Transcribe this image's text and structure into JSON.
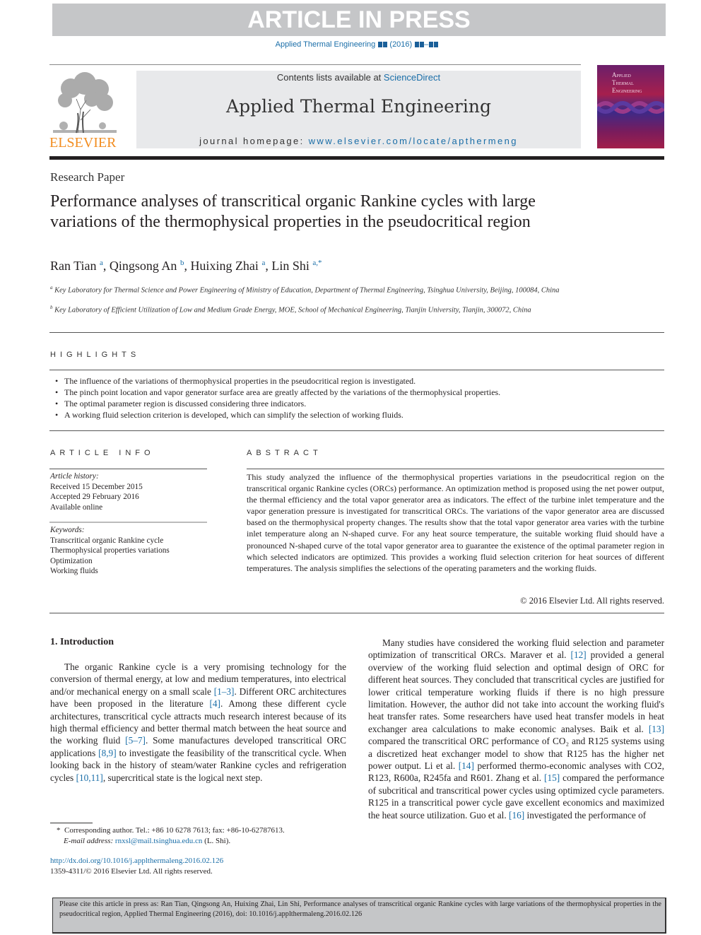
{
  "banner": {
    "text": "ARTICLE IN PRESS"
  },
  "journal_ref": {
    "journal": "Applied Thermal Engineering",
    "year": "(2016)"
  },
  "header": {
    "publisher_logo_text": "ELSEVIER",
    "contents_prefix": "Contents lists available at ",
    "contents_link": "ScienceDirect",
    "journal_title": "Applied Thermal Engineering",
    "homepage_prefix": "journal homepage: ",
    "homepage_link": "www.elsevier.com/locate/apthermeng",
    "cover_title_lines": [
      "Applied",
      "Thermal",
      "Engineering"
    ]
  },
  "article": {
    "type": "Research Paper",
    "title": "Performance analyses of transcritical organic Rankine cycles with large variations of the thermophysical properties in the pseudocritical region",
    "authors": [
      {
        "name": "Ran Tian",
        "sup": "a",
        "sep": ", "
      },
      {
        "name": "Qingsong An",
        "sup": "b",
        "sep": ", "
      },
      {
        "name": "Huixing Zhai",
        "sup": "a",
        "sep": ", "
      },
      {
        "name": "Lin Shi",
        "sup": "a,*",
        "sep": ""
      }
    ],
    "affiliations": [
      {
        "sup": "a",
        "text": "Key Laboratory for Thermal Science and Power Engineering of Ministry of Education, Department of Thermal Engineering, Tsinghua University, Beijing, 100084, China"
      },
      {
        "sup": "b",
        "text": "Key Laboratory of Efficient Utilization of Low and Medium Grade Energy, MOE, School of Mechanical Engineering, Tianjin University, Tianjin, 300072, China"
      }
    ]
  },
  "highlights": {
    "heading": "HIGHLIGHTS",
    "items": [
      "The influence of the variations of thermophysical properties in the pseudocritical region is investigated.",
      "The pinch point location and vapor generator surface area are greatly affected by the variations of the thermophysical properties.",
      "The optimal parameter region is discussed considering three indicators.",
      "A working fluid selection criterion is developed, which can simplify the selection of working fluids."
    ]
  },
  "article_info": {
    "heading": "ARTICLE INFO",
    "history_label": "Article history:",
    "history": [
      "Received 15 December 2015",
      "Accepted 29 February 2016",
      "Available online"
    ],
    "keywords_label": "Keywords:",
    "keywords": [
      "Transcritical organic Rankine cycle",
      "Thermophysical properties variations",
      "Optimization",
      "Working fluids"
    ]
  },
  "abstract": {
    "heading": "ABSTRACT",
    "text": "This study analyzed the influence of the thermophysical properties variations in the pseudocritical region on the transcritical organic Rankine cycles (ORCs) performance. An optimization method is proposed using the net power output, the thermal efficiency and the total vapor generator area as indicators. The effect of the turbine inlet temperature and the vapor generation pressure is investigated for transcritical ORCs. The variations of the vapor generator area are discussed based on the thermophysical property changes. The results show that the total vapor generator area varies with the turbine inlet temperature along an N-shaped curve. For any heat source temperature, the suitable working fluid should have a pronounced N-shaped curve of the total vapor generator area to guarantee the existence of the optimal parameter region in which selected indicators are optimized. This provides a working fluid selection criterion for heat sources of different temperatures. The analysis simplifies the selections of the operating parameters and the working fluids.",
    "copyright": "© 2016 Elsevier Ltd. All rights reserved."
  },
  "introduction": {
    "heading": "1.  Introduction",
    "left_col": [
      {
        "t": "The organic Rankine cycle is a very promising technology for the conversion of thermal energy, at low and medium temperatures, into electrical and/or mechanical energy on a small scale "
      },
      {
        "c": "[1–3]"
      },
      {
        "t": ". Different ORC architectures have been proposed in the literature "
      },
      {
        "c": "[4]"
      },
      {
        "t": ". Among these different cycle architectures, transcritical cycle attracts much research interest because of its high thermal efficiency and better thermal match between the heat source and the working fluid "
      },
      {
        "c": "[5–7]"
      },
      {
        "t": ". Some manufactures developed transcritical ORC applications "
      },
      {
        "c": "[8,9]"
      },
      {
        "t": " to investigate the feasibility of the transcritical cycle. When looking back in the history of steam/water Rankine cycles and refrigeration cycles "
      },
      {
        "c": "[10,11]"
      },
      {
        "t": ", supercritical state is the logical next step."
      }
    ],
    "right_col": [
      {
        "t": "Many studies have considered the working fluid selection and parameter optimization of transcritical ORCs. Maraver et al. "
      },
      {
        "c": "[12]"
      },
      {
        "t": " provided a general overview of the working fluid selection and optimal design of ORC for different heat sources. They concluded that transcritical cycles are justified for lower critical temperature working fluids if there is no high pressure limitation. However, the author did not take into account the working fluid's heat transfer rates. Some researchers have used heat transfer models in heat exchanger area calculations to make economic analyses. Baik et al. "
      },
      {
        "c": "[13]"
      },
      {
        "t": " compared the transcritical ORC performance of CO₂ and R125 systems using a discretized heat exchanger model to show that R125 has the higher net power output. Li et al. "
      },
      {
        "c": "[14]"
      },
      {
        "t": " performed thermo-economic analyses with CO2, R123, R600a, R245fa and R601. Zhang et al. "
      },
      {
        "c": "[15]"
      },
      {
        "t": " compared the performance of subcritical and transcritical power cycles using optimized cycle parameters. R125 in a transcritical power cycle gave excellent economics and maximized the heat source utilization. Guo et al. "
      },
      {
        "c": "[16]"
      },
      {
        "t": " investigated the performance of"
      }
    ]
  },
  "footnote": {
    "marker": "*",
    "text": "Corresponding author. Tel.: +86 10 6278 7613; fax: +86-10-62787613.",
    "email_label": "E-mail address: ",
    "email": "rnxsl@mail.tsinghua.edu.cn",
    "email_suffix": " (L. Shi)."
  },
  "doi": {
    "url": "http://dx.doi.org/10.1016/j.applthermaleng.2016.02.126",
    "issn_line": "1359-4311/© 2016 Elsevier Ltd. All rights reserved."
  },
  "citation_box": {
    "text": "Please cite this article in press as: Ran Tian, Qingsong An, Huixing Zhai, Lin Shi, Performance analyses of transcritical organic Rankine cycles with large variations of the thermophysical properties in the pseudocritical region, Applied Thermal Engineering (2016), doi: 10.1016/j.applthermaleng.2016.02.126"
  },
  "colors": {
    "link": "#1a6ea8",
    "elsevier_orange": "#f28d20",
    "banner_gray": "#c5c6c8"
  }
}
